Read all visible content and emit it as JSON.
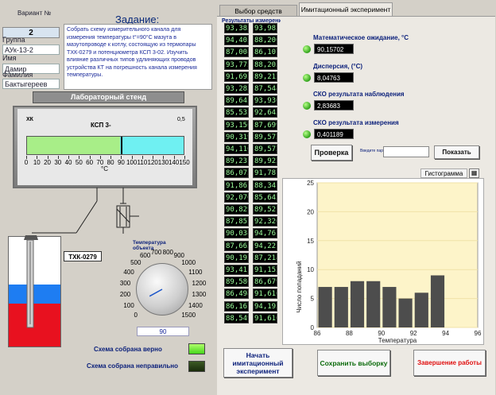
{
  "variant": {
    "label": "Вариант №",
    "value": "2"
  },
  "fields": {
    "group_label": "Группа",
    "group_value": "АУк-13-2",
    "name_label": "Имя",
    "name_value": "Дамир",
    "surname_label": "Фамилия",
    "surname_value": "Бактыгереев"
  },
  "task": {
    "title": "Задание:",
    "text": "Собрать схему измерительного канала для измерения температуры t°=90°C мазута в мазутопроводе к котлу, состоящую из термопары ТХК-0279 и потенциометра КСП 3-02. Изучить влияние различных типов удлиняющих проводов устройства КТ на погрешность канала измерения температуры."
  },
  "lab_stand_title": "Лабораторный стенд",
  "instrument": {
    "type_label": "ХК",
    "model_label": "КСП 3-",
    "class_label": "0,5",
    "value": 90,
    "scale_min": 0,
    "scale_max": 150,
    "ticks": [
      "0",
      "10",
      "20",
      "30",
      "40",
      "50",
      "60",
      "70",
      "80",
      "90",
      "100",
      "110",
      "120",
      "130",
      "140",
      "150"
    ],
    "unit": "°C",
    "colors": {
      "left": "#a8ee88",
      "right": "#6ff0f2",
      "pointer": "#000000"
    }
  },
  "thermocouple_tag": "ТХК-0279",
  "knob": {
    "title": "Температура объекта",
    "ticks": [
      "0",
      "100",
      "200",
      "300",
      "400",
      "500",
      "600",
      "700",
      "800",
      "900",
      "1000",
      "1100",
      "1200",
      "1300",
      "1400",
      "1500"
    ],
    "value": 90,
    "value_display": "90"
  },
  "status": {
    "ok_label": "Схема собрана верно",
    "bad_label": "Схема собрана неправильно",
    "ok_state": true,
    "bad_state": false
  },
  "tabs": [
    {
      "label": "Выбор средств измерения"
    },
    {
      "label": "Имитационный эксперимент"
    }
  ],
  "measurements": {
    "header": "Результаты измерений",
    "col1": [
      "93,385",
      "94,403",
      "87,008",
      "93,772",
      "91,693",
      "93,285",
      "89,645",
      "85,535",
      "93,156",
      "90,319",
      "94,110",
      "89,231",
      "86,075",
      "91,861",
      "92,070",
      "90,829",
      "87,857",
      "90,034",
      "87,663",
      "90,195",
      "93,411",
      "89,580",
      "86,494",
      "86,167",
      "88,549"
    ],
    "col2": [
      "93,983",
      "88,206",
      "86,107",
      "88,205",
      "89,212",
      "87,544",
      "93,936",
      "92,643",
      "87,699",
      "89,572",
      "89,572",
      "89,922",
      "91,781",
      "88,341",
      "85,642",
      "89,521",
      "92,326",
      "94,761",
      "94,221",
      "87,214",
      "91,152",
      "86,679",
      "91,616",
      "94,193",
      "91,616"
    ]
  },
  "stats": [
    {
      "label": "Математическое ожидание, °C",
      "value": "90,15702"
    },
    {
      "label": "Дисперсия, (°C)",
      "value": "8,04763"
    },
    {
      "label": "СКО результата наблюдения",
      "value": "2,83683"
    },
    {
      "label": "СКО результата измерения",
      "value": "0,401189"
    }
  ],
  "controls": {
    "check_label": "Проверка",
    "password_label": "Введите пароль",
    "password_value": "",
    "show_label": "Показать"
  },
  "histogram_tab": "Гистограмма",
  "chart_data": {
    "type": "bar",
    "title": "",
    "xlabel": "Температура",
    "ylabel": "Число попаданий",
    "xlim": [
      86,
      96
    ],
    "ylim": [
      0,
      25
    ],
    "x_ticks": [
      "86",
      "88",
      "90",
      "92",
      "94",
      "96"
    ],
    "y_ticks": [
      "0",
      "5",
      "10",
      "15",
      "20",
      "25"
    ],
    "categories": [
      "86",
      "87",
      "88",
      "89",
      "90",
      "91",
      "92",
      "93",
      "94"
    ],
    "values": [
      7,
      7,
      8,
      8,
      7,
      5,
      6,
      9,
      0
    ],
    "bar_color": "#4d4d4d",
    "plot_bg": "#fdf4c9",
    "grid": true
  },
  "buttons": {
    "start": "Начать имитационный эксперимент",
    "save": "Сохранить выборку",
    "finish": "Завершение работы"
  }
}
